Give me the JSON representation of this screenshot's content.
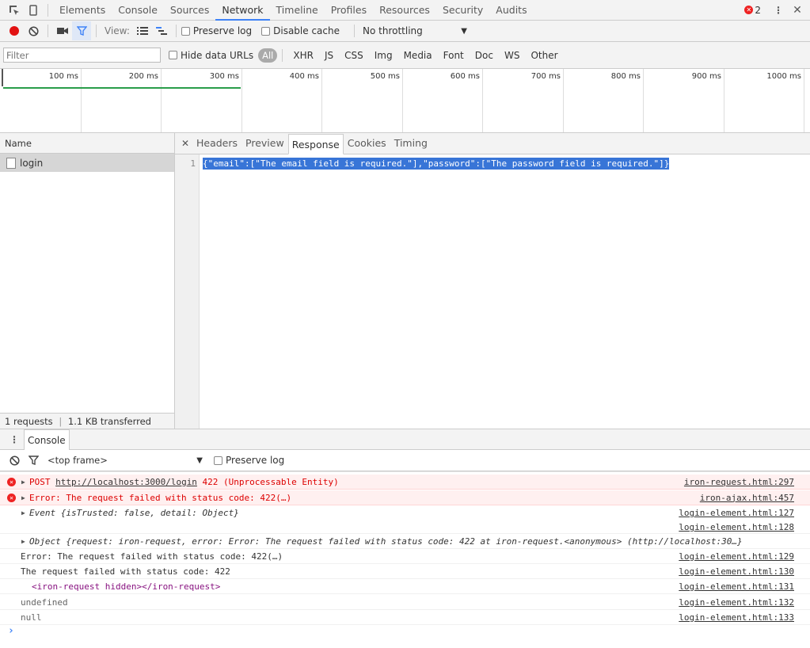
{
  "toolbar": {
    "tabs": [
      "Elements",
      "Console",
      "Sources",
      "Network",
      "Timeline",
      "Profiles",
      "Resources",
      "Security",
      "Audits"
    ],
    "active_tab": "Network",
    "error_count": "2"
  },
  "network_toolbar": {
    "view_label": "View:",
    "preserve_log": "Preserve log",
    "disable_cache": "Disable cache",
    "throttling": "No throttling"
  },
  "filter_bar": {
    "placeholder": "Filter",
    "hide_data_urls": "Hide data URLs",
    "types": [
      "All",
      "XHR",
      "JS",
      "CSS",
      "Img",
      "Media",
      "Font",
      "Doc",
      "WS",
      "Other"
    ]
  },
  "timeline": {
    "ticks": [
      "100 ms",
      "200 ms",
      "300 ms",
      "400 ms",
      "500 ms",
      "600 ms",
      "700 ms",
      "800 ms",
      "900 ms",
      "1000 ms"
    ]
  },
  "requests": {
    "header": "Name",
    "items": [
      "login"
    ],
    "status": "1 requests",
    "transferred": "1.1 KB transferred"
  },
  "detail": {
    "tabs": [
      "Headers",
      "Preview",
      "Response",
      "Cookies",
      "Timing"
    ],
    "active_tab": "Response",
    "line_number": "1",
    "response": "{\"email\":[\"The email field is required.\"],\"password\":[\"The password field is required.\"]}"
  },
  "drawer": {
    "tab": "Console",
    "context": "<top frame>",
    "preserve_log": "Preserve log"
  },
  "console": {
    "messages": [
      {
        "pre": "POST ",
        "link": "http://localhost:3000/login",
        "post": " 422 (Unprocessable Entity)",
        "src": "iron-request.html:297"
      },
      {
        "text": "Error: The request failed with status code: 422(…)",
        "src": "iron-ajax.html:457"
      },
      {
        "text": "Event {isTrusted: false, detail: Object}",
        "src": "login-element.html:127"
      },
      {
        "text": "",
        "src": "login-element.html:128"
      },
      {
        "text": "Object {request: iron-request, error: Error: The request failed with status code: 422 at iron-request.<anonymous> (http://localhost:30…}"
      },
      {
        "text": "Error: The request failed with status code: 422(…)",
        "src": "login-element.html:129"
      },
      {
        "text": "The request failed with status code: 422",
        "src": "login-element.html:130"
      },
      {
        "text": "<iron-request hidden></iron-request>",
        "src": "login-element.html:131"
      },
      {
        "text": "undefined",
        "src": "login-element.html:132"
      },
      {
        "text": "null",
        "src": "login-element.html:133"
      }
    ],
    "prompt": "›"
  }
}
